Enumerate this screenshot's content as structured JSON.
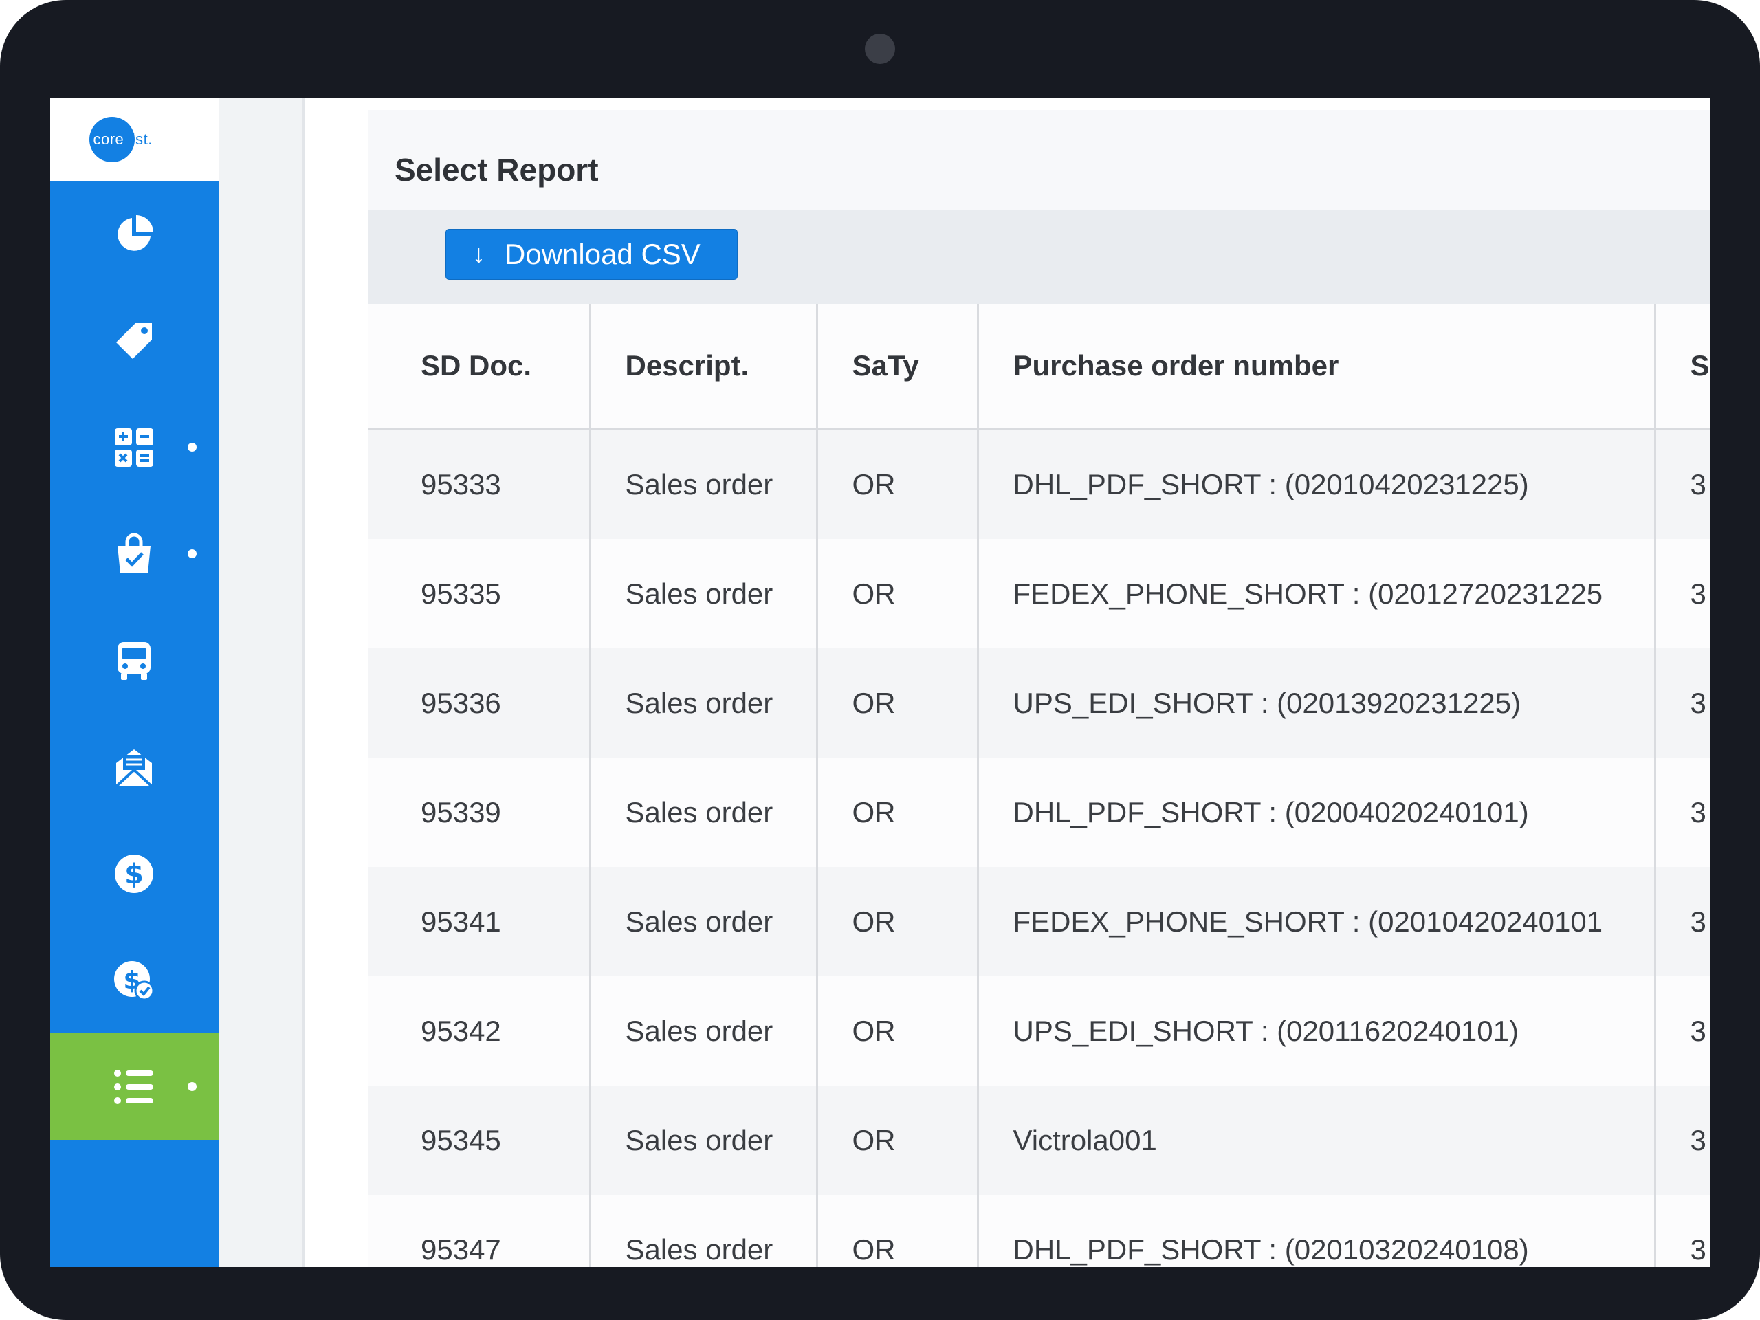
{
  "brand": {
    "logo_text_left": "core",
    "logo_text_right": "vist."
  },
  "sidebar": {
    "items": [
      {
        "name": "dashboard",
        "icon": "pie-chart-icon",
        "has_dot": false,
        "active": false
      },
      {
        "name": "pricing",
        "icon": "tag-icon",
        "has_dot": false,
        "active": false
      },
      {
        "name": "catalog",
        "icon": "calculator-grid-icon",
        "has_dot": true,
        "active": false
      },
      {
        "name": "orders",
        "icon": "shopping-bag-check-icon",
        "has_dot": true,
        "active": false
      },
      {
        "name": "shipping",
        "icon": "bus-icon",
        "has_dot": false,
        "active": false
      },
      {
        "name": "messages",
        "icon": "envelope-open-icon",
        "has_dot": false,
        "active": false
      },
      {
        "name": "payments",
        "icon": "dollar-circle-icon",
        "has_dot": false,
        "active": false
      },
      {
        "name": "invoices",
        "icon": "dollar-check-icon",
        "has_dot": false,
        "active": false
      },
      {
        "name": "reports",
        "icon": "list-icon",
        "has_dot": true,
        "active": true
      }
    ],
    "colors": {
      "primary": "#1380e3",
      "active": "#7ac143"
    }
  },
  "page": {
    "title": "Select Report",
    "download_label": "Download CSV"
  },
  "table": {
    "headers": [
      "SD Doc.",
      "Descript.",
      "SaTy",
      "Purchase order number",
      "S"
    ],
    "rows": [
      [
        "95333",
        "Sales order",
        "OR",
        "DHL_PDF_SHORT : (02010420231225)",
        "3"
      ],
      [
        "95335",
        "Sales order",
        "OR",
        "FEDEX_PHONE_SHORT : (02012720231225",
        "3"
      ],
      [
        "95336",
        "Sales order",
        "OR",
        "UPS_EDI_SHORT : (02013920231225)",
        "3"
      ],
      [
        "95339",
        "Sales order",
        "OR",
        "DHL_PDF_SHORT : (02004020240101)",
        "3"
      ],
      [
        "95341",
        "Sales order",
        "OR",
        "FEDEX_PHONE_SHORT : (02010420240101",
        "3"
      ],
      [
        "95342",
        "Sales order",
        "OR",
        "UPS_EDI_SHORT : (02011620240101)",
        "3"
      ],
      [
        "95345",
        "Sales order",
        "OR",
        "Victrola001",
        "3"
      ],
      [
        "95347",
        "Sales order",
        "OR",
        "DHL_PDF_SHORT : (02010320240108)",
        "3"
      ]
    ]
  }
}
